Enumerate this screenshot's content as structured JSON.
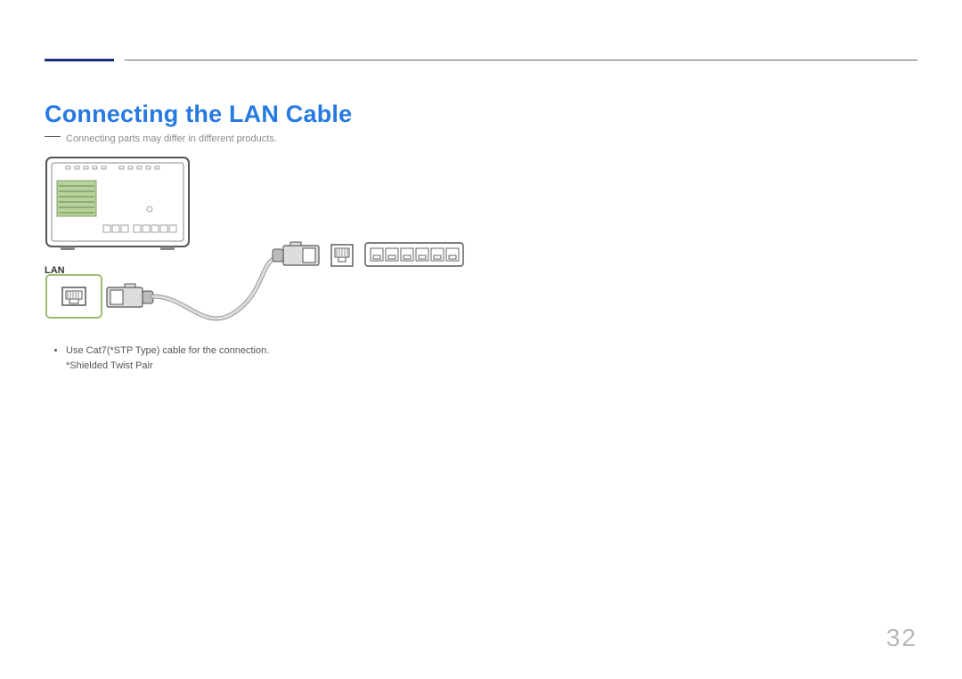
{
  "heading": "Connecting the LAN Cable",
  "note": "Connecting parts may differ in different products.",
  "panel_label": "LAN",
  "bullet": {
    "line1": "Use Cat7(*STP Type) cable for the connection.",
    "sub": "*Shielded Twist Pair"
  },
  "page_number": "32"
}
